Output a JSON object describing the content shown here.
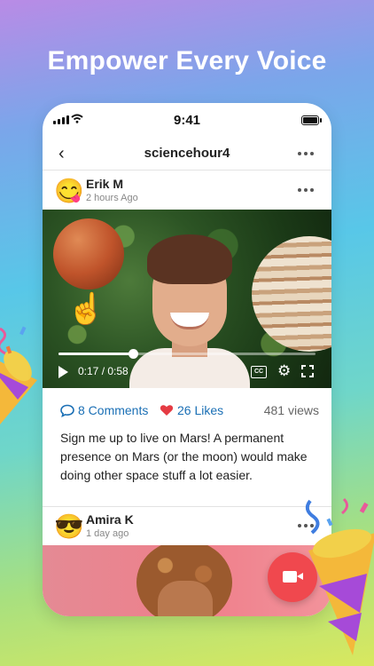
{
  "headline": "Empower Every Voice",
  "status_bar": {
    "time": "9:41"
  },
  "nav": {
    "back_icon": "chevron-left-icon",
    "title": "sciencehour4",
    "more_icon": "more-horizontal-icon"
  },
  "post": {
    "author": "Erik M",
    "timestamp": "2 hours Ago",
    "avatar": "😋",
    "video": {
      "current_time": "0:17 / 0:58",
      "progress": 0.29,
      "cc_label": "CC",
      "finger_emoji": "☝️"
    },
    "comments_label": "8 Comments",
    "likes_label": "26 Likes",
    "views_label": "481 views",
    "caption": "Sign me up to live on Mars! A permanent presence on Mars (or the moon) would make doing other space stuff a lot easier."
  },
  "post2": {
    "author": "Amira K",
    "timestamp": "1 day ago",
    "avatar": "😎"
  },
  "colors": {
    "link": "#1a6fb5",
    "record": "#f0484e",
    "heart": "#e53b43"
  }
}
